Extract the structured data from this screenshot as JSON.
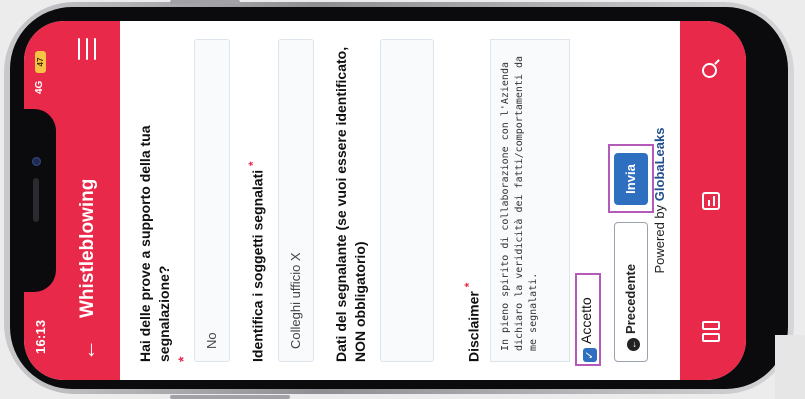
{
  "status_bar": {
    "time": "16:13",
    "network": "4G",
    "battery": "47"
  },
  "header": {
    "title": "Whistleblowing"
  },
  "form": {
    "q1": {
      "label": "Hai delle prove a supporto della tua segnalazione?",
      "required_marker": "*",
      "value": "No"
    },
    "q2": {
      "label": "Identifica i soggetti segnalati",
      "required_marker": "*",
      "value": "Colleghi ufficio X"
    },
    "q3": {
      "label": "Dati del segnalante (se vuoi essere identificato, NON obbligatorio)",
      "value": ""
    },
    "q4": {
      "label": "Disclaimer",
      "required_marker": "*",
      "text": "In pieno spirito di collaborazione con l'Azienda dichiaro la veridicità dei fatti/comportamenti da me segnalati."
    },
    "accept_label": "Accetto",
    "accept_checked": true
  },
  "actions": {
    "previous_label": "Precedente",
    "send_label": "Invia"
  },
  "footer": {
    "powered_prefix": "Powered by",
    "powered_brand": "GlobaLeaks"
  },
  "bottom_nav": {
    "items": [
      "pages-icon",
      "document-icon",
      "search-icon"
    ]
  },
  "colors": {
    "brand": "#e8294a",
    "primary_button": "#2f6fbf",
    "highlight": "#b45ab8"
  }
}
